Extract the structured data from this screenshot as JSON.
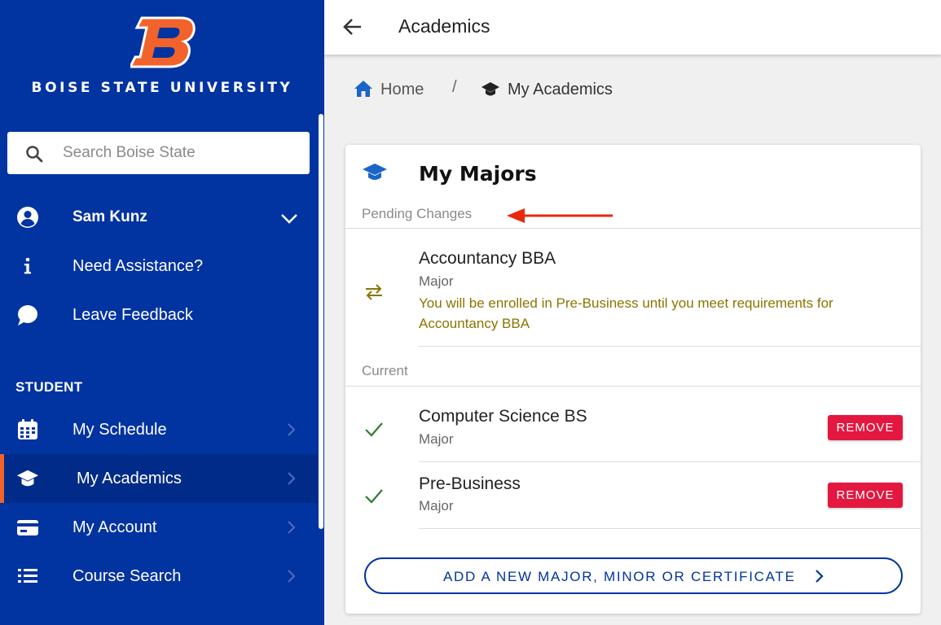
{
  "sidebar": {
    "university_name": "BOISE STATE UNIVERSITY",
    "logo_letter": "B",
    "search_placeholder": "Search Boise State",
    "user_name": "Sam Kunz",
    "links": {
      "assistance": "Need Assistance?",
      "feedback": "Leave Feedback"
    },
    "section_heading": "STUDENT",
    "nav": {
      "schedule": "My Schedule",
      "academics": "My Academics",
      "account": "My Account",
      "course_search": "Course Search"
    },
    "active_item": "My Academics"
  },
  "topbar": {
    "title": "Academics"
  },
  "breadcrumb": {
    "home": "Home",
    "separator": "/",
    "current": "My Academics"
  },
  "card": {
    "title": "My Majors",
    "pending_label": "Pending Changes",
    "pending": {
      "name": "Accountancy BBA",
      "type": "Major",
      "note": "You will be enrolled in Pre-Business until you meet requirements for Accountancy BBA"
    },
    "current_label": "Current",
    "current": [
      {
        "name": "Computer Science BS",
        "type": "Major",
        "action": "REMOVE"
      },
      {
        "name": "Pre-Business",
        "type": "Major",
        "action": "REMOVE"
      }
    ],
    "add_button": "ADD A NEW MAJOR, MINOR OR CERTIFICATE"
  },
  "colors": {
    "brand_blue": "#0133a1",
    "brand_orange": "#f1632a",
    "remove_red": "#e3173f",
    "check_green": "#2e7d32",
    "pending_gold": "#8a7500",
    "annotation_arrow": "#e8290b"
  },
  "icons": {
    "logo": "boise-state-b-logo",
    "search": "search-icon",
    "user": "account-circle-icon",
    "user_expand": "chevron-down-icon",
    "assistance": "info-icon",
    "feedback": "chat-bubble-icon",
    "schedule": "calendar-icon",
    "academics": "graduation-cap-icon",
    "account": "credit-card-icon",
    "course_search": "list-icon",
    "back": "arrow-left-icon",
    "home": "home-icon",
    "pending": "swap-arrows-icon",
    "current": "check-icon"
  }
}
